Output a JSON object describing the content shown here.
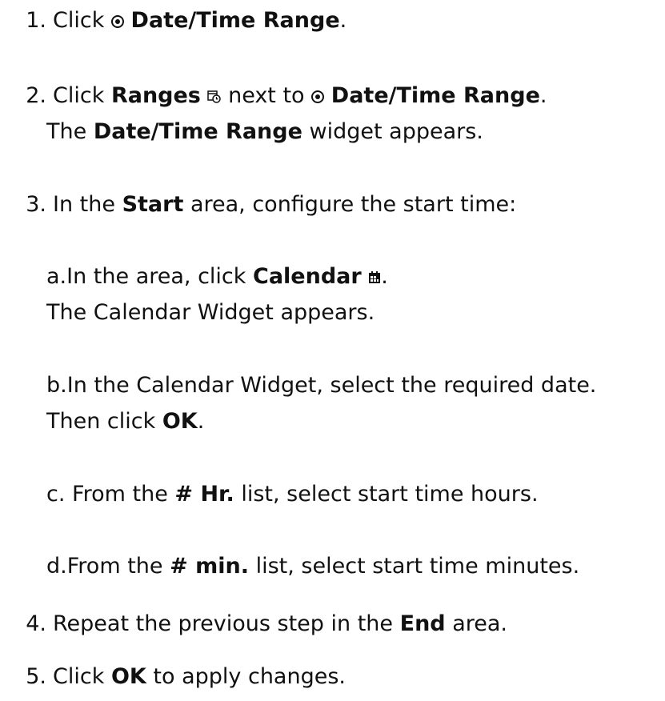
{
  "steps": [
    {
      "num": "1.",
      "text_before": "Click",
      "icon": "radio-button-icon",
      "bold": "Date/Time Range",
      "text_after": "."
    },
    {
      "num": "2.",
      "text_before": "Click",
      "bold": "Ranges",
      "icon": "ranges-clock-icon",
      "mid": "next to",
      "icon2": "radio-button-icon",
      "bold2": "Date/Time Range",
      "text_after": ".",
      "line2_pre": "The",
      "line2_bold": "Date/Time Range",
      "line2_post": "widget appears."
    },
    {
      "num": "3.",
      "text_before": "In the",
      "bold": "Start",
      "text_after": "area, configure the start time:",
      "substeps": [
        {
          "letter": "a.",
          "text_before": "In the area, click",
          "bold": "Calendar",
          "icon": "calendar-icon",
          "text_after": ".",
          "line2": "The Calendar Widget appears."
        },
        {
          "letter": "b.",
          "text": "In the Calendar Widget, select the required date.",
          "line2_pre": "Then click",
          "line2_bold": "OK",
          "line2_post": "."
        },
        {
          "letter": "c.",
          "text_before": "From the",
          "bold": "# Hr.",
          "text_after": "list, select start time hours."
        },
        {
          "letter": "d.",
          "text_before": "From the",
          "bold": "# min.",
          "text_after": "list, select start time minutes."
        }
      ]
    },
    {
      "num": "4.",
      "text_before": "Repeat the previous step in the",
      "bold": "End",
      "text_after": "area."
    },
    {
      "num": "5.",
      "text_before": "Click",
      "bold": "OK",
      "text_after": "to apply changes."
    }
  ]
}
